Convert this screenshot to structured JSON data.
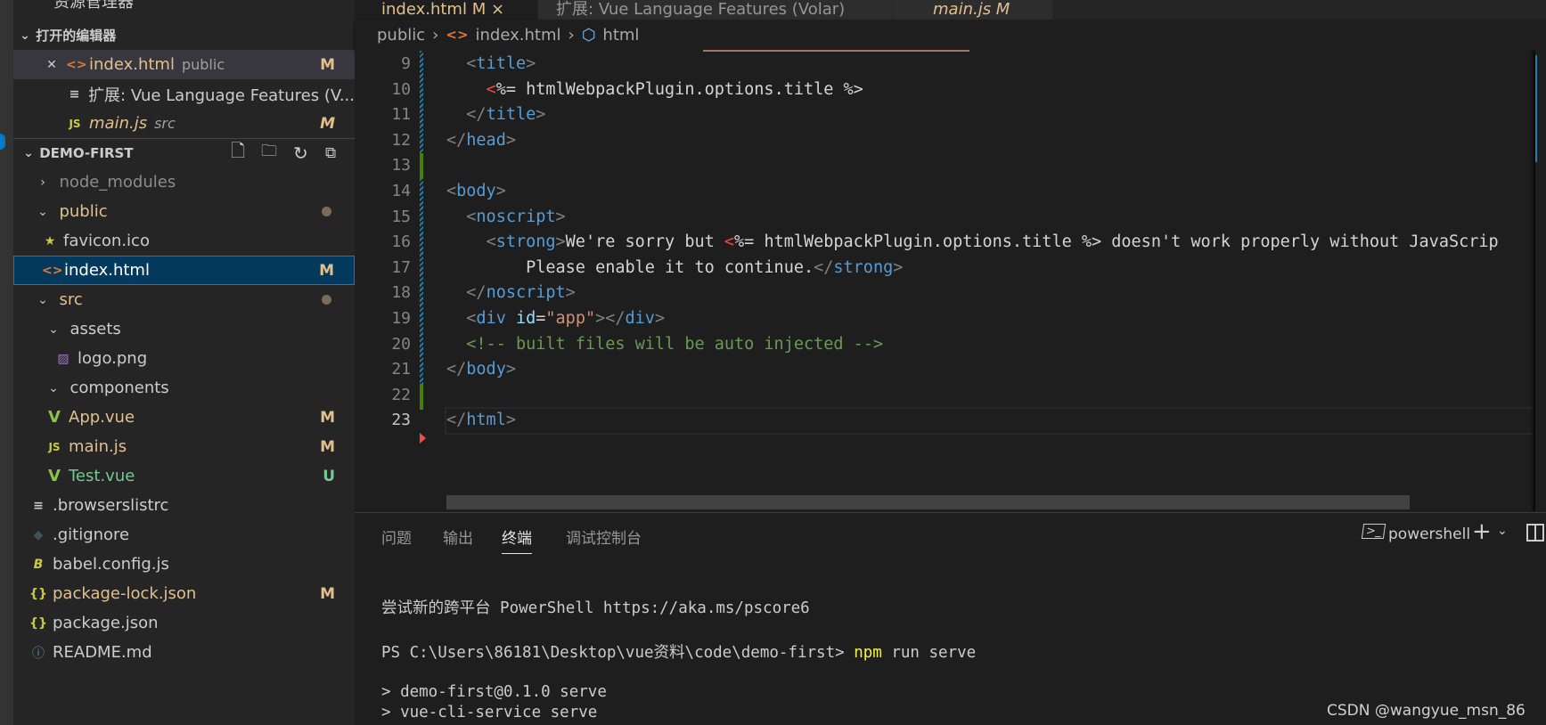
{
  "sidebar": {
    "header": "资源管理器",
    "open_editors": {
      "title": "打开的编辑器",
      "items": [
        {
          "name": "index.html",
          "desc": "public",
          "status": "M"
        },
        {
          "name": "扩展: Vue Language Features (V...",
          "desc": "",
          "status": ""
        },
        {
          "name": "main.js",
          "desc": "src",
          "status": "M"
        }
      ]
    },
    "workspace": {
      "title": "DEMO-FIRST",
      "items": [
        {
          "name": "node_modules"
        },
        {
          "name": "public"
        },
        {
          "name": "favicon.ico"
        },
        {
          "name": "index.html",
          "status": "M"
        },
        {
          "name": "src"
        },
        {
          "name": "assets"
        },
        {
          "name": "logo.png"
        },
        {
          "name": "components"
        },
        {
          "name": "App.vue",
          "status": "M"
        },
        {
          "name": "main.js",
          "status": "M"
        },
        {
          "name": "Test.vue",
          "status": "U"
        },
        {
          "name": ".browserslistrc"
        },
        {
          "name": ".gitignore"
        },
        {
          "name": "babel.config.js"
        },
        {
          "name": "package-lock.json",
          "status": "M"
        },
        {
          "name": "package.json"
        },
        {
          "name": "README.md"
        }
      ]
    }
  },
  "tabs": [
    {
      "label": "index.html M ×"
    },
    {
      "label": "扩展: Vue Language Features (Volar)"
    },
    {
      "label": "main.js M"
    }
  ],
  "breadcrumb": [
    "public",
    "index.html",
    "html"
  ],
  "editor": {
    "lines": [
      {
        "n": "9",
        "tokens": [
          [
            "x",
            "  "
          ],
          [
            "b",
            "<"
          ],
          [
            "t",
            "title"
          ],
          [
            "b",
            ">"
          ]
        ]
      },
      {
        "n": "10",
        "tokens": [
          [
            "x",
            "    "
          ],
          [
            "r",
            "<"
          ],
          [
            "x",
            "%= htmlWebpackPlugin.options.title %>"
          ]
        ]
      },
      {
        "n": "11",
        "tokens": [
          [
            "x",
            "  "
          ],
          [
            "b",
            "</"
          ],
          [
            "t",
            "title"
          ],
          [
            "b",
            ">"
          ]
        ]
      },
      {
        "n": "12",
        "tokens": [
          [
            "b",
            "</"
          ],
          [
            "t",
            "head"
          ],
          [
            "b",
            ">"
          ]
        ]
      },
      {
        "n": "13",
        "tokens": []
      },
      {
        "n": "14",
        "tokens": [
          [
            "b",
            "<"
          ],
          [
            "t",
            "body"
          ],
          [
            "b",
            ">"
          ]
        ]
      },
      {
        "n": "15",
        "tokens": [
          [
            "x",
            "  "
          ],
          [
            "b",
            "<"
          ],
          [
            "t",
            "noscript"
          ],
          [
            "b",
            ">"
          ]
        ]
      },
      {
        "n": "16",
        "tokens": [
          [
            "x",
            "    "
          ],
          [
            "b",
            "<"
          ],
          [
            "t",
            "strong"
          ],
          [
            "b",
            ">"
          ],
          [
            "x",
            "We're sorry but "
          ],
          [
            "r",
            "<"
          ],
          [
            "x",
            "%= htmlWebpackPlugin.options.title %> doesn't work properly without JavaScrip"
          ]
        ]
      },
      {
        "n": "17",
        "tokens": [
          [
            "x",
            "        Please enable it to continue."
          ],
          [
            "b",
            "</"
          ],
          [
            "t",
            "strong"
          ],
          [
            "b",
            ">"
          ]
        ]
      },
      {
        "n": "18",
        "tokens": [
          [
            "x",
            "  "
          ],
          [
            "b",
            "</"
          ],
          [
            "t",
            "noscript"
          ],
          [
            "b",
            ">"
          ]
        ]
      },
      {
        "n": "19",
        "tokens": [
          [
            "x",
            "  "
          ],
          [
            "b",
            "<"
          ],
          [
            "t",
            "div"
          ],
          [
            "x",
            " "
          ],
          [
            "a",
            "id"
          ],
          [
            "x",
            "="
          ],
          [
            "s",
            "\"app\""
          ],
          [
            "b",
            "></"
          ],
          [
            "t",
            "div"
          ],
          [
            "b",
            ">"
          ]
        ]
      },
      {
        "n": "20",
        "tokens": [
          [
            "x",
            "  "
          ],
          [
            "c",
            "<!-- built files will be auto injected -->"
          ]
        ]
      },
      {
        "n": "21",
        "tokens": [
          [
            "b",
            "</"
          ],
          [
            "t",
            "body"
          ],
          [
            "b",
            ">"
          ]
        ]
      },
      {
        "n": "22",
        "tokens": []
      },
      {
        "n": "23",
        "tokens": [
          [
            "b",
            "</"
          ],
          [
            "t",
            "html"
          ],
          [
            "b",
            ">"
          ]
        ]
      }
    ]
  },
  "panel": {
    "tabs": [
      "问题",
      "输出",
      "终端",
      "调试控制台"
    ],
    "active_tab": "终端",
    "shell": "powershell",
    "terminal": {
      "line1": "尝试新的跨平台 PowerShell https://aka.ms/pscore6",
      "prompt": "PS C:\\Users\\86181\\Desktop\\vue资料\\code\\demo-first> ",
      "cmd": "npm",
      "args": " run serve",
      "out1": "> demo-first@0.1.0 serve",
      "out2": "> vue-cli-service serve"
    }
  },
  "watermark": "CSDN @wangyue_msn_86",
  "colors": {
    "modified": "#e2c08d",
    "untracked": "#73c991",
    "selection": "#04395e",
    "accent": "#007fd4"
  }
}
